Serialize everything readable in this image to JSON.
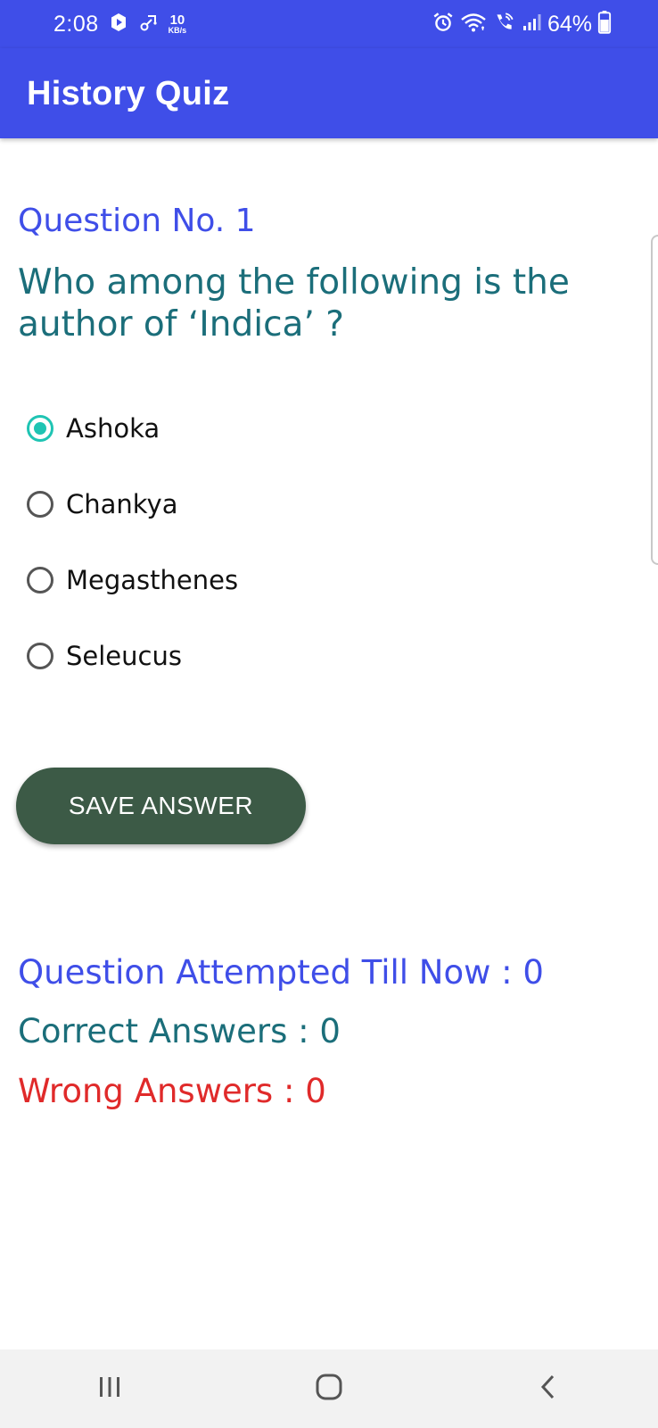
{
  "colors": {
    "accent": "#3f4ee8",
    "question_text": "#1b6e7a",
    "radio_checked": "#1fc4b3",
    "button": "#3c5a46",
    "wrong": "#e02a2a"
  },
  "status_bar": {
    "time": "2:08",
    "net_speed_value": "10",
    "net_speed_unit": "KB/s",
    "battery": "64%",
    "icons": [
      "media-play-icon",
      "share-link-icon",
      "alarm-icon",
      "wifi-icon",
      "wifi-calling-icon",
      "signal-bars-icon",
      "battery-icon"
    ]
  },
  "app_bar": {
    "title": "History Quiz"
  },
  "quiz": {
    "question_number_label": "Question No. 1",
    "question_text": "Who among the following is the author of ‘Indica’ ?",
    "options": [
      {
        "label": "Ashoka",
        "selected": true
      },
      {
        "label": "Chankya",
        "selected": false
      },
      {
        "label": "Megasthenes",
        "selected": false
      },
      {
        "label": "Seleucus",
        "selected": false
      }
    ],
    "save_button_label": "SAVE ANSWER"
  },
  "stats": {
    "attempted": "Question Attempted Till Now : 0",
    "correct": "Correct Answers : 0",
    "wrong": "Wrong Answers : 0"
  },
  "nav_bar": {
    "icons": [
      "recent-apps-icon",
      "home-icon",
      "back-icon"
    ]
  }
}
